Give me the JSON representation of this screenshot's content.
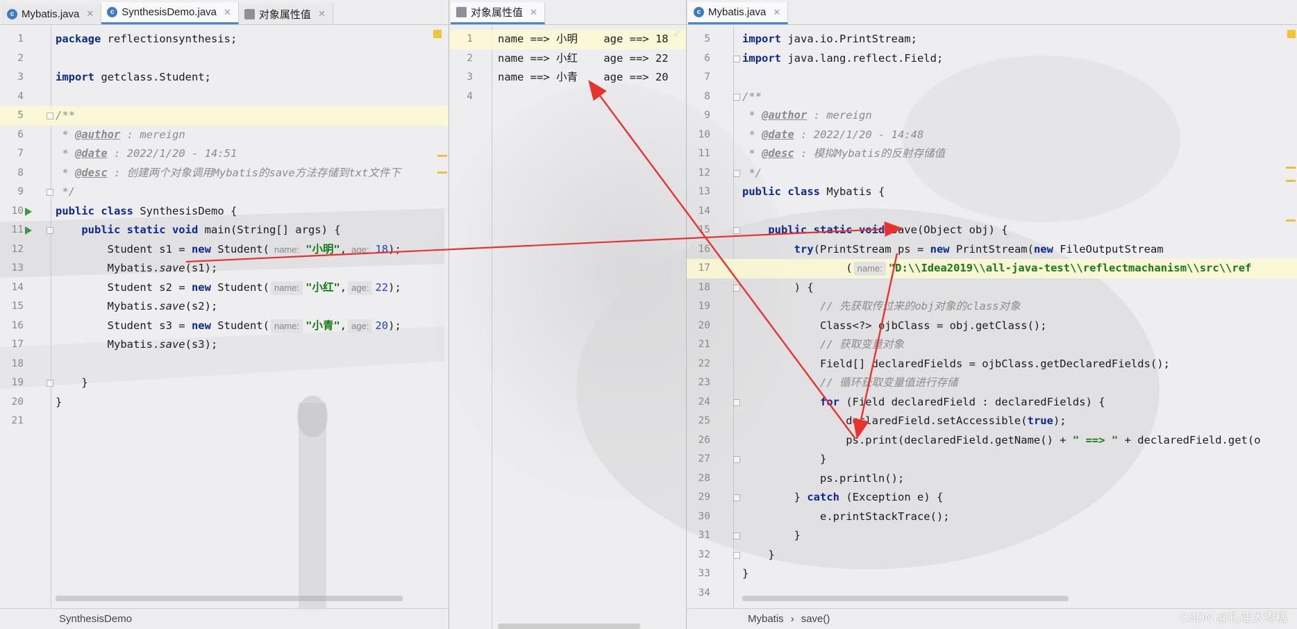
{
  "left": {
    "tabs": [
      {
        "label": "Mybatis.java",
        "icon": "class-icon"
      },
      {
        "label": "SynthesisDemo.java",
        "icon": "class-icon",
        "active": true
      },
      {
        "label": "对象属性值",
        "icon": "text-file-icon"
      }
    ],
    "line_numbers": [
      "1",
      "2",
      "3",
      "4",
      "5",
      "6",
      "7",
      "8",
      "9",
      "10",
      "11",
      "12",
      "13",
      "14",
      "15",
      "16",
      "17",
      "18",
      "19",
      "20",
      "21"
    ],
    "code": {
      "l1_kw": "package",
      "l1_rest": " reflectionsynthesis;",
      "l3_kw": "import",
      "l3_rest": " getclass.Student;",
      "l5": "/**",
      "l6_pre": " * ",
      "l6_tag": "@author",
      "l6_rest": " : mereign",
      "l7_pre": " * ",
      "l7_tag": "@date",
      "l7_rest": " : 2022/1/20 - 14:51",
      "l8_pre": " * ",
      "l8_tag": "@desc",
      "l8_rest": " : 创建两个对象调用Mybatis的save方法存储到txt文件下",
      "l9": " */",
      "l10_kw1": "public",
      "l10_kw2": " class",
      "l10_rest": " SynthesisDemo {",
      "l11_kw": "    public static void",
      "l11_rest": " main(String[] args) {",
      "l12_a": "        Student s1 = ",
      "l12_new": "new",
      "l12_b": " Student(",
      "hint_name": "name:",
      "hint_age": "age:",
      "l12_str": "\"小明\"",
      "comma": ",",
      "l12_num": "18",
      "close": ");",
      "l13_a": "        Mybatis.",
      "save": "save",
      "l13_b": "(s1);",
      "l14_a": "        Student s2 = ",
      "l14_str": "\"小红\"",
      "l14_num": "22",
      "l15_b": "(s2);",
      "l16_a": "        Student s3 = ",
      "l16_str": "\"小青\"",
      "l16_num": "20",
      "l17_b": "(s3);",
      "l19": "    }",
      "l20": "}"
    },
    "status": "SynthesisDemo"
  },
  "middle": {
    "tabs": [
      {
        "label": "对象属性值",
        "icon": "text-file-icon",
        "active": true
      }
    ],
    "line_numbers": [
      "1",
      "2",
      "3",
      "4"
    ],
    "rows": [
      {
        "text": "name ==> 小明    age ==> 18"
      },
      {
        "text": "name ==> 小红    age ==> 22"
      },
      {
        "text": "name ==> 小青    age ==> 20"
      }
    ]
  },
  "right": {
    "tabs": [
      {
        "label": "Mybatis.java",
        "icon": "class-icon",
        "active": true
      }
    ],
    "line_numbers": [
      "5",
      "6",
      "7",
      "8",
      "9",
      "10",
      "11",
      "12",
      "13",
      "14",
      "15",
      "16",
      "17",
      "18",
      "19",
      "20",
      "21",
      "22",
      "23",
      "24",
      "25",
      "26",
      "27",
      "28",
      "29",
      "30",
      "31",
      "32",
      "33",
      "34"
    ],
    "code": {
      "l5_kw": "import",
      "l5_rest": " java.io.PrintStream;",
      "l6_kw": "import",
      "l6_rest": " java.lang.reflect.Field;",
      "l8": "/**",
      "l9_pre": " * ",
      "l9_tag": "@author",
      "l9_rest": " : mereign",
      "l10_pre": " * ",
      "l10_tag": "@date",
      "l10_rest": " : 2022/1/20 - 14:48",
      "l11_pre": " * ",
      "l11_tag": "@desc",
      "l11_rest": " : 模拟Mybatis的反射存储值",
      "l12": " */",
      "l13_kw": "public class",
      "l13_rest": " Mybatis {",
      "l15_kw": "    public static void",
      "l15_rest": " save(Object obj) {",
      "l16_kw": "        try",
      "l16_a": "(PrintStream ps = ",
      "l16_new": "new",
      "l16_b": " PrintStream(",
      "l16_new2": "new",
      "l16_c": " FileOutputStream",
      "l17_a": "                (",
      "l17_hint": "name:",
      "l17_str": "\"D:\\\\Idea2019\\\\all-java-test\\\\reflectmachanism\\\\src\\\\ref",
      "l18": "        ) {",
      "l19": "            // 先获取传过来的obj对象的class对象",
      "l20": "            Class<?> ojbClass = obj.getClass();",
      "l21": "            // 获取变量对象",
      "l22": "            Field[] declaredFields = ojbClass.getDeclaredFields();",
      "l23": "            // 循环获取变量值进行存储",
      "l24_kw": "            for",
      "l24_rest": " (Field declaredField : declaredFields) {",
      "l25_a": "                declaredField.setAccessible(",
      "l25_kw": "true",
      "l25_b": ");",
      "l26_a": "                ps.print(declaredField.getName() + ",
      "l26_str": "\" ==> \"",
      "l26_b": " + declaredField.get(o",
      "l27": "            }",
      "l28": "            ps.println();",
      "l29_a": "        } ",
      "l29_kw": "catch",
      "l29_b": " (Exception e) {",
      "l30": "            e.printStackTrace();",
      "l31": "        }",
      "l32": "    }",
      "l33": "}"
    },
    "status_class": "Mybatis",
    "status_sep": "›",
    "status_method": "save()"
  },
  "watermark": "CSDN @扎哇太枣糕",
  "colors": {
    "keyword": "#0b2990",
    "string": "#157a15",
    "number": "#1f3fd3",
    "arrow": "#e8322e",
    "run_marker": "#3c9a3c"
  }
}
